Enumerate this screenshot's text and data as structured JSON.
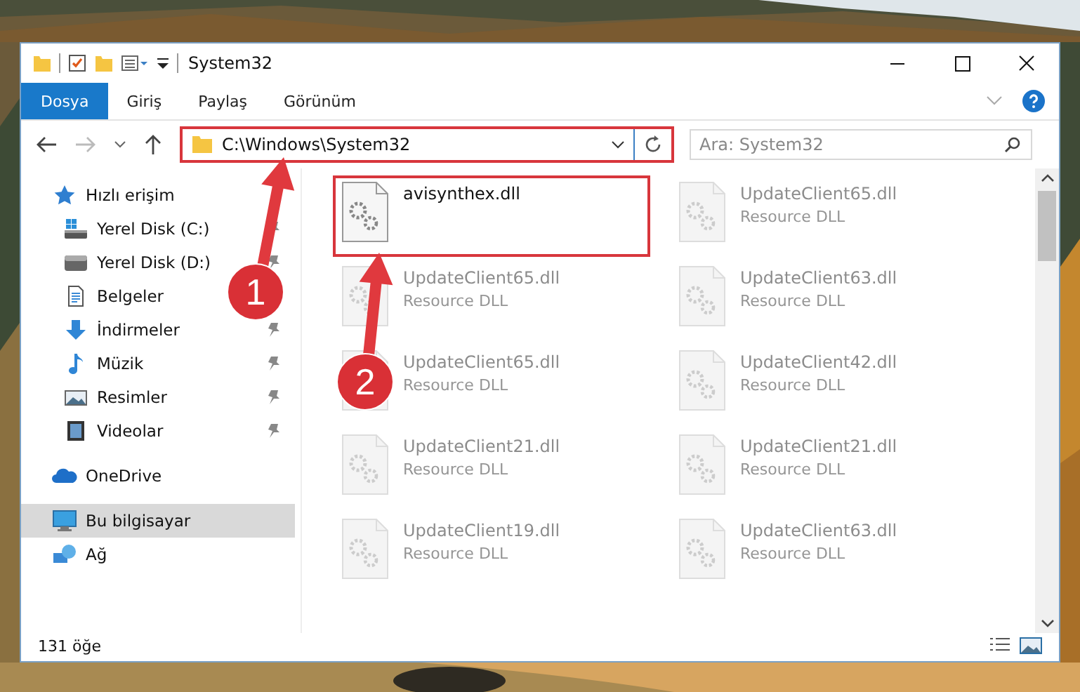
{
  "window": {
    "title": "System32"
  },
  "ribbon": {
    "tabs": [
      {
        "label": "Dosya",
        "selected": true
      },
      {
        "label": "Giriş",
        "selected": false
      },
      {
        "label": "Paylaş",
        "selected": false
      },
      {
        "label": "Görünüm",
        "selected": false
      }
    ]
  },
  "address": {
    "path": "C:\\Windows\\System32",
    "highlighted": true
  },
  "search": {
    "placeholder": "Ara: System32"
  },
  "sidebar": {
    "items": [
      {
        "label": "Hızlı erişim",
        "kind": "star",
        "pinned": false,
        "selected": false,
        "children": [
          {
            "label": "Yerel Disk (C:)",
            "kind": "system-drive",
            "pinned": true,
            "selected": false
          },
          {
            "label": "Yerel Disk (D:)",
            "kind": "drive",
            "pinned": true,
            "selected": false
          },
          {
            "label": "Belgeler",
            "kind": "document",
            "pinned": false,
            "selected": false
          },
          {
            "label": "İndirmeler",
            "kind": "download",
            "pinned": true,
            "selected": false
          },
          {
            "label": "Müzik",
            "kind": "music",
            "pinned": true,
            "selected": false
          },
          {
            "label": "Resimler",
            "kind": "pictures",
            "pinned": true,
            "selected": false
          },
          {
            "label": "Videolar",
            "kind": "video",
            "pinned": true,
            "selected": false
          }
        ]
      },
      {
        "label": "OneDrive",
        "kind": "cloud",
        "pinned": false,
        "selected": false
      },
      {
        "label": "Bu bilgisayar",
        "kind": "computer",
        "pinned": false,
        "selected": true
      },
      {
        "label": "Ağ",
        "kind": "network",
        "pinned": false,
        "selected": false
      }
    ]
  },
  "files": [
    {
      "name": "avisynthex.dll",
      "highlighted": true,
      "blurred": false
    },
    {
      "name": "UpdateClient65.dll",
      "type": "Resource DLL",
      "highlighted": false,
      "blurred": true
    },
    {
      "name": "UpdateClient65.dll",
      "type": "Resource DLL",
      "highlighted": false,
      "blurred": true
    },
    {
      "name": "UpdateClient63.dll",
      "type": "Resource DLL",
      "highlighted": false,
      "blurred": true
    },
    {
      "name": "UpdateClient65.dll",
      "type": "Resource DLL",
      "highlighted": false,
      "blurred": true
    },
    {
      "name": "UpdateClient42.dll",
      "type": "Resource DLL",
      "highlighted": false,
      "blurred": true
    },
    {
      "name": "UpdateClient21.dll",
      "type": "Resource DLL",
      "highlighted": false,
      "blurred": true
    },
    {
      "name": "UpdateClient21.dll",
      "type": "Resource DLL",
      "highlighted": false,
      "blurred": true
    },
    {
      "name": "UpdateClient19.dll",
      "type": "Resource DLL",
      "highlighted": false,
      "blurred": true
    },
    {
      "name": "UpdateClient63.dll",
      "type": "Resource DLL",
      "highlighted": false,
      "blurred": true
    }
  ],
  "callouts": [
    {
      "number": "1"
    },
    {
      "number": "2"
    }
  ],
  "status_bar": {
    "count": "131 öğe"
  }
}
